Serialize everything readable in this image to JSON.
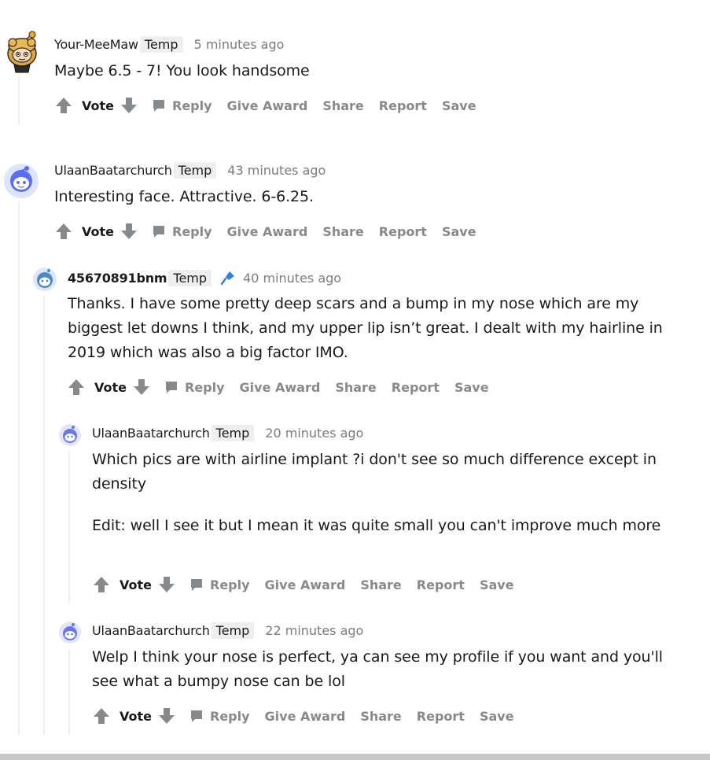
{
  "actions": {
    "vote": "Vote",
    "reply": "Reply",
    "give_award": "Give Award",
    "share": "Share",
    "report": "Report",
    "save": "Save"
  },
  "comments": [
    {
      "author": "Your-MeeMaw",
      "flair": "Temp",
      "time": "5 minutes ago",
      "body": [
        "Maybe 6.5 - 7! You look handsome"
      ]
    },
    {
      "author": "UlaanBaatarchurch",
      "flair": "Temp",
      "time": "43 minutes ago",
      "body": [
        "Interesting face. Attractive. 6-6.25."
      ]
    },
    {
      "author": "45670891bnm",
      "flair": "Temp",
      "time": "40 minutes ago",
      "is_op": true,
      "body": [
        "Thanks. I have some pretty deep scars and a bump in my nose which are my biggest let downs I think, and my upper lip isn’t great. I dealt with my hairline in 2019 which was also a big factor IMO."
      ]
    },
    {
      "author": "UlaanBaatarchurch",
      "flair": "Temp",
      "time": "20 minutes ago",
      "body": [
        "Which pics are with airline implant ?i don't see so much difference except in density",
        "Edit: well I see it but I mean it was quite small you can't improve much more"
      ]
    },
    {
      "author": "UlaanBaatarchurch",
      "flair": "Temp",
      "time": "22 minutes ago",
      "body": [
        "Welp I think your nose is perfect, ya can see my profile if you want and you'll see what a bumpy nose can be lol"
      ]
    }
  ]
}
